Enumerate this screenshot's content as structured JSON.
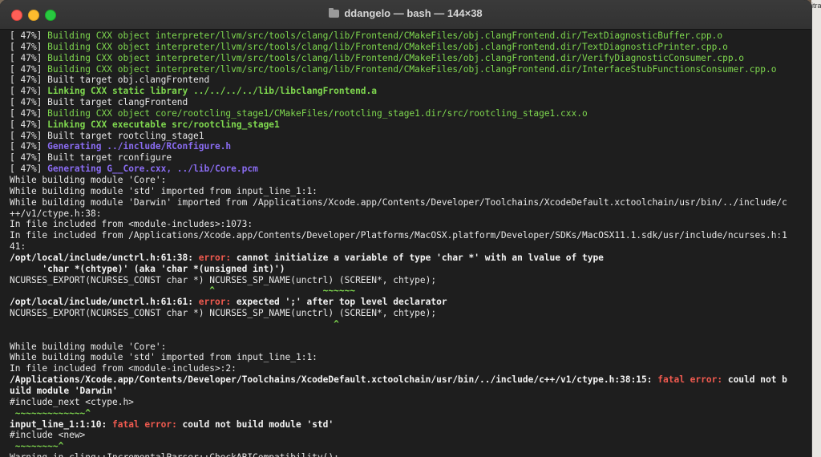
{
  "window": {
    "title": "ddangelo — bash — 144×38"
  },
  "desktop_right_text": "itra",
  "lines": [
    {
      "parts": [
        {
          "t": "[ 47%] "
        },
        {
          "t": "Building CXX object interpreter/llvm/src/tools/clang/lib/Frontend/CMakeFiles/obj.clangFrontend.dir/TextDiagnosticBuffer.cpp.o",
          "c": "g"
        }
      ]
    },
    {
      "parts": [
        {
          "t": "[ 47%] "
        },
        {
          "t": "Building CXX object interpreter/llvm/src/tools/clang/lib/Frontend/CMakeFiles/obj.clangFrontend.dir/TextDiagnosticPrinter.cpp.o",
          "c": "g"
        }
      ]
    },
    {
      "parts": [
        {
          "t": "[ 47%] "
        },
        {
          "t": "Building CXX object interpreter/llvm/src/tools/clang/lib/Frontend/CMakeFiles/obj.clangFrontend.dir/VerifyDiagnosticConsumer.cpp.o",
          "c": "g"
        }
      ]
    },
    {
      "parts": [
        {
          "t": "[ 47%] "
        },
        {
          "t": "Building CXX object interpreter/llvm/src/tools/clang/lib/Frontend/CMakeFiles/obj.clangFrontend.dir/InterfaceStubFunctionsConsumer.cpp.o",
          "c": "g"
        }
      ]
    },
    {
      "parts": [
        {
          "t": "[ 47%] Built target obj.clangFrontend"
        }
      ]
    },
    {
      "parts": [
        {
          "t": "[ 47%] "
        },
        {
          "t": "Linking CXX static library ../../../../lib/libclangFrontend.a",
          "c": "gb"
        }
      ]
    },
    {
      "parts": [
        {
          "t": "[ 47%] Built target clangFrontend"
        }
      ]
    },
    {
      "parts": [
        {
          "t": "[ 47%] "
        },
        {
          "t": "Building CXX object core/rootcling_stage1/CMakeFiles/rootcling_stage1.dir/src/rootcling_stage1.cxx.o",
          "c": "g"
        }
      ]
    },
    {
      "parts": [
        {
          "t": "[ 47%] "
        },
        {
          "t": "Linking CXX executable src/rootcling_stage1",
          "c": "gb"
        }
      ]
    },
    {
      "parts": [
        {
          "t": "[ 47%] Built target rootcling_stage1"
        }
      ]
    },
    {
      "parts": [
        {
          "t": "[ 47%] "
        },
        {
          "t": "Generating ../include/RConfigure.h",
          "c": "p"
        }
      ]
    },
    {
      "parts": [
        {
          "t": "[ 47%] Built target rconfigure"
        }
      ]
    },
    {
      "parts": [
        {
          "t": "[ 47%] "
        },
        {
          "t": "Generating G__Core.cxx, ../lib/Core.pcm",
          "c": "p"
        }
      ]
    },
    {
      "parts": [
        {
          "t": "While building module 'Core':"
        }
      ]
    },
    {
      "parts": [
        {
          "t": "While building module 'std' imported from input_line_1:1:"
        }
      ]
    },
    {
      "parts": [
        {
          "t": "While building module 'Darwin' imported from /Applications/Xcode.app/Contents/Developer/Toolchains/XcodeDefault.xctoolchain/usr/bin/../include/c"
        }
      ]
    },
    {
      "parts": [
        {
          "t": "++/v1/ctype.h:38:"
        }
      ]
    },
    {
      "parts": [
        {
          "t": "In file included from <module-includes>:1073:"
        }
      ]
    },
    {
      "parts": [
        {
          "t": "In file included from /Applications/Xcode.app/Contents/Developer/Platforms/MacOSX.platform/Developer/SDKs/MacOSX11.1.sdk/usr/include/ncurses.h:1"
        }
      ]
    },
    {
      "parts": [
        {
          "t": "41:"
        }
      ]
    },
    {
      "parts": [
        {
          "t": "/opt/local/include/unctrl.h:61:38: ",
          "c": "b"
        },
        {
          "t": "error: ",
          "c": "r"
        },
        {
          "t": "cannot initialize a variable of type 'char *' with an lvalue of type",
          "c": "b"
        }
      ]
    },
    {
      "parts": [
        {
          "t": "      'char *(chtype)' (aka 'char *(unsigned int)')",
          "c": "b"
        }
      ]
    },
    {
      "parts": [
        {
          "t": "NCURSES_EXPORT(NCURSES_CONST char *) NCURSES_SP_NAME(unctrl) (SCREEN*, chtype);"
        }
      ]
    },
    {
      "parts": [
        {
          "t": "                                     ^                    ~~~~~~",
          "c": "caret"
        }
      ]
    },
    {
      "parts": [
        {
          "t": "/opt/local/include/unctrl.h:61:61: ",
          "c": "b"
        },
        {
          "t": "error: ",
          "c": "r"
        },
        {
          "t": "expected ';' after top level declarator",
          "c": "b"
        }
      ]
    },
    {
      "parts": [
        {
          "t": "NCURSES_EXPORT(NCURSES_CONST char *) NCURSES_SP_NAME(unctrl) (SCREEN*, chtype);"
        }
      ]
    },
    {
      "parts": [
        {
          "t": "                                                            ^",
          "c": "caret"
        }
      ]
    },
    {
      "parts": [
        {
          "t": ""
        }
      ]
    },
    {
      "parts": [
        {
          "t": "While building module 'Core':"
        }
      ]
    },
    {
      "parts": [
        {
          "t": "While building module 'std' imported from input_line_1:1:"
        }
      ]
    },
    {
      "parts": [
        {
          "t": "In file included from <module-includes>:2:"
        }
      ]
    },
    {
      "parts": [
        {
          "t": "/Applications/Xcode.app/Contents/Developer/Toolchains/XcodeDefault.xctoolchain/usr/bin/../include/c++/v1/ctype.h:38:15: ",
          "c": "b"
        },
        {
          "t": "fatal error: ",
          "c": "r"
        },
        {
          "t": "could not b",
          "c": "b"
        }
      ]
    },
    {
      "parts": [
        {
          "t": "uild module 'Darwin'",
          "c": "b"
        }
      ]
    },
    {
      "parts": [
        {
          "t": "#include_next <ctype.h>"
        }
      ]
    },
    {
      "parts": [
        {
          "t": " ~~~~~~~~~~~~~^",
          "c": "caret"
        }
      ]
    },
    {
      "parts": [
        {
          "t": "input_line_1:1:10: ",
          "c": "b"
        },
        {
          "t": "fatal error: ",
          "c": "r"
        },
        {
          "t": "could not build module 'std'",
          "c": "b"
        }
      ]
    },
    {
      "parts": [
        {
          "t": "#include <new>"
        }
      ]
    },
    {
      "parts": [
        {
          "t": " ~~~~~~~~^",
          "c": "caret"
        }
      ]
    },
    {
      "parts": [
        {
          "t": "Warning in cling::IncrementalParser::CheckABICompatibility():"
        }
      ]
    }
  ]
}
